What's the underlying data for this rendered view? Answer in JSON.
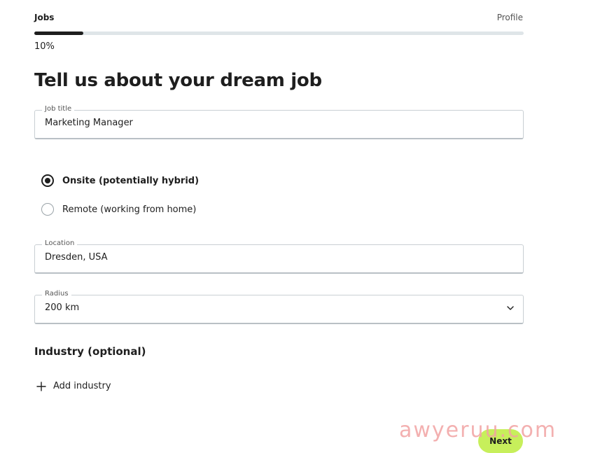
{
  "steps": {
    "current": "Jobs",
    "next": "Profile"
  },
  "progress": {
    "percent": 10,
    "label": "10%",
    "fill_color": "#1e1e1e"
  },
  "page_title": "Tell us about your dream job",
  "job_title": {
    "label": "Job title",
    "value": "Marketing Manager"
  },
  "work_mode": {
    "options": [
      {
        "label": "Onsite (potentially hybrid)",
        "selected": true
      },
      {
        "label": "Remote (working from home)",
        "selected": false
      }
    ]
  },
  "location": {
    "label": "Location",
    "value": "Dresden, USA"
  },
  "radius": {
    "label": "Radius",
    "value": "200 km",
    "icon": "chevron-down-icon"
  },
  "industry": {
    "heading": "Industry (optional)",
    "add_label": "Add industry",
    "icon": "plus-icon"
  },
  "next_button": {
    "label": "Next",
    "color": "#c7ef5b"
  },
  "watermark": "awyeruu.com"
}
